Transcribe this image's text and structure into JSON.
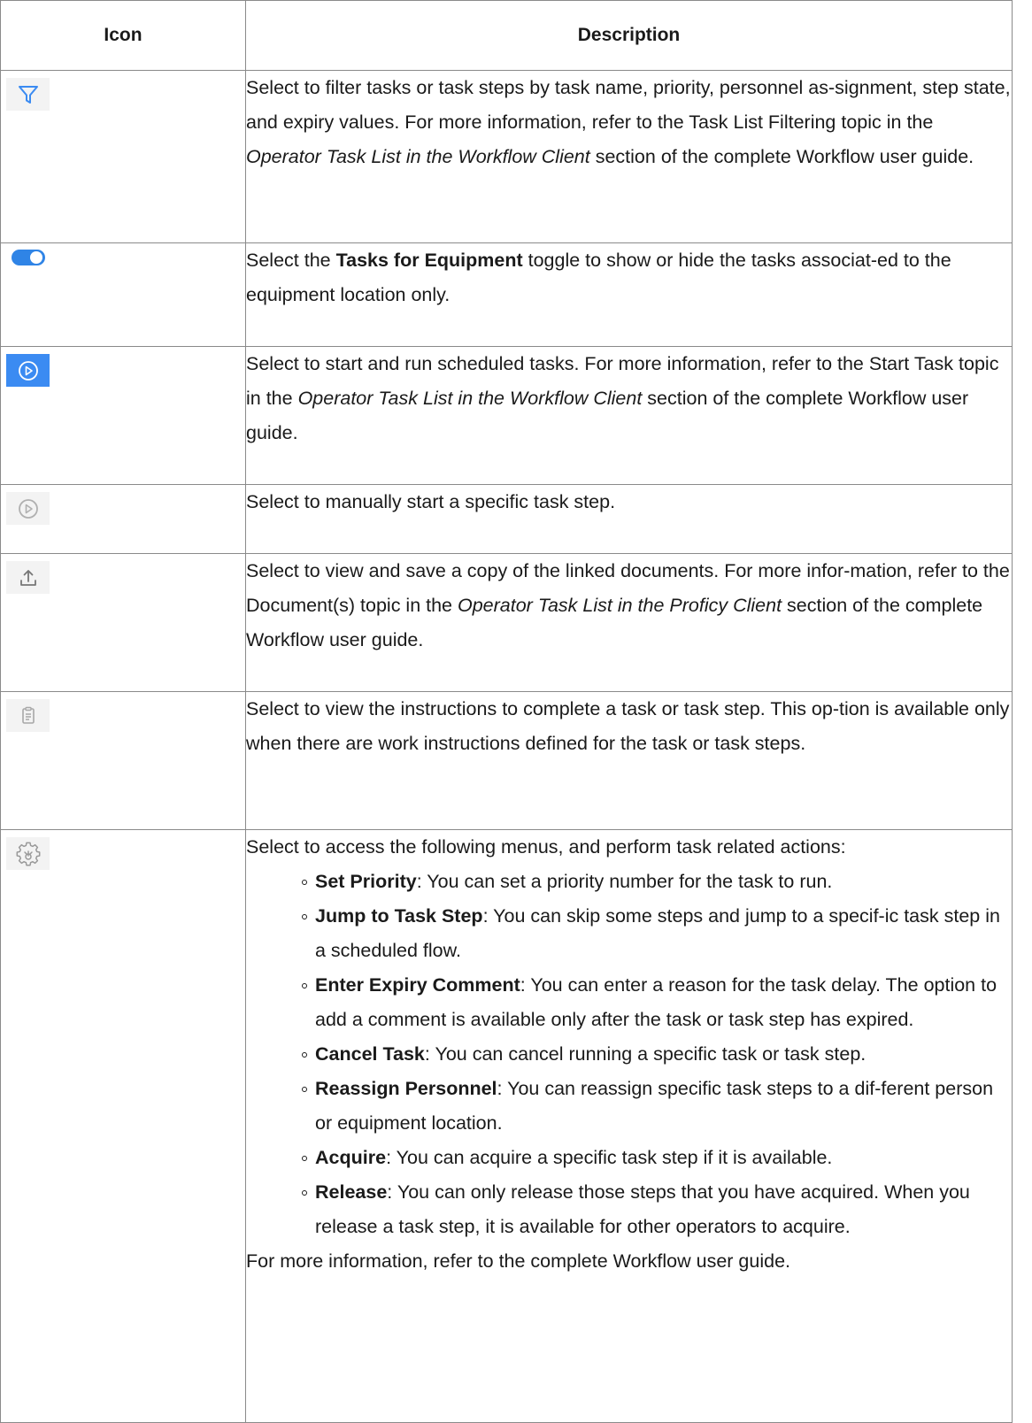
{
  "table": {
    "header": {
      "icon": "Icon",
      "description": "Description"
    },
    "rows": [
      {
        "icon": "filter-icon",
        "parts": [
          "Select to filter tasks or task steps by task name, priority, personnel as-signment, step state, and expiry values. For more information, refer to the Task List Filtering topic in the ",
          "Operator Task List in the Workflow Client",
          " section of the complete Workflow user guide."
        ]
      },
      {
        "icon": "toggle-icon",
        "parts": [
          "Select the ",
          "Tasks for Equipment",
          " toggle to show or hide the tasks associat-ed to the equipment location only."
        ]
      },
      {
        "icon": "play-circle-blue-icon",
        "parts": [
          "Select to start and run scheduled tasks. For more information, refer to the Start Task topic in the ",
          "Operator Task List in the Workflow Client",
          " section of the complete Workflow user guide."
        ]
      },
      {
        "icon": "play-circle-gray-icon",
        "parts": [
          "Select to manually start a specific task step."
        ]
      },
      {
        "icon": "upload-icon",
        "parts": [
          "Select to view and save a copy of the linked documents. For more infor-mation, refer to the Document(s) topic in the ",
          "Operator Task List in the Proficy Client",
          " section of the complete Workflow user guide."
        ]
      },
      {
        "icon": "clipboard-icon",
        "parts": [
          "Select to view the instructions to complete a task or task step. This op-tion is available only when there are work instructions defined for the task or task steps."
        ]
      },
      {
        "icon": "gear-icon",
        "intro": "Select to access the following menus, and perform task related actions:",
        "menus": [
          {
            "name": "Set Priority",
            "text": ": You can set a priority number for the task to run."
          },
          {
            "name": "Jump to Task Step",
            "text": ": You can skip some steps and jump to a specif-ic task step in a scheduled flow."
          },
          {
            "name": "Enter Expiry Comment",
            "text": ": You can enter a reason for the task delay. The option to add a comment is available only after the task or task step has expired."
          },
          {
            "name": "Cancel Task",
            "text": ": You can cancel running a specific task or task step."
          },
          {
            "name": "Reassign Personnel",
            "text": ": You can reassign specific task steps to a dif-ferent person or equipment location."
          },
          {
            "name": "Acquire",
            "text": ": You can acquire a specific task step if it is available."
          },
          {
            "name": "Release",
            "text": ": You can only release those steps that you have acquired. When you release a task step, it is available for other operators to acquire."
          }
        ],
        "outro": "For more information, refer to the complete Workflow user guide."
      }
    ]
  },
  "colors": {
    "accent_blue": "#3b8bf2",
    "border": "#8a8a8a"
  }
}
